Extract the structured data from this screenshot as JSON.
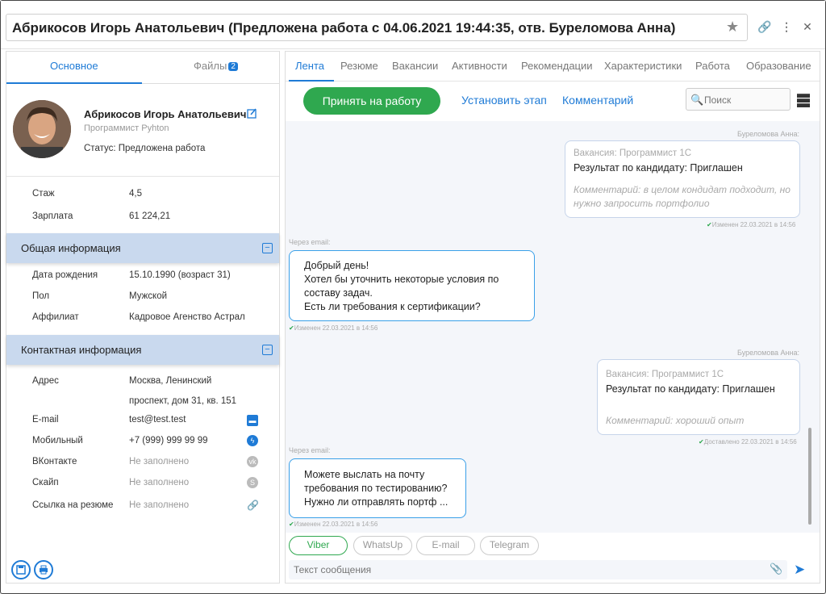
{
  "window": {
    "title": "Абрикосов Игорь Анатольевич (Предложена работа с 04.06.2021 19:44:35, отв. Буреломова Анна)"
  },
  "left": {
    "tabs": [
      {
        "label": "Основное"
      },
      {
        "label": "Файлы",
        "badge": "2"
      }
    ],
    "profile": {
      "name": "Абрикосов Игорь Анатольевич",
      "position": "Программист Pyhton",
      "status": "Статус: Предложена работа"
    },
    "summary": [
      {
        "label": "Стаж",
        "value": "4,5"
      },
      {
        "label": "Зарплата",
        "value": "61 224,21"
      }
    ],
    "general_title": "Общая информация",
    "general": [
      {
        "label": "Дата рождения",
        "value": "15.10.1990 (возраст 31)"
      },
      {
        "label": "Пол",
        "value": "Мужской"
      },
      {
        "label": "Аффилиат",
        "value": "Кадровое Агенство Астрал"
      }
    ],
    "contact_title": "Контактная информация",
    "contact": [
      {
        "label": "Адрес",
        "value": "Москва, Ленинский",
        "value2": "проспект, дом 31, кв. 151"
      },
      {
        "label": "E-mail",
        "value": "test@test.test"
      },
      {
        "label": "Мобильный",
        "value": "+7 (999) 999 99 99"
      },
      {
        "label": "ВКонтакте",
        "value": "Не заполнено"
      },
      {
        "label": "Скайп",
        "value": "Не заполнено"
      },
      {
        "label": "Ссылка на резюме",
        "value": "Не заполнено"
      }
    ]
  },
  "right": {
    "tabs": [
      "Лента",
      "Резюме",
      "Вакансии",
      "Активности",
      "Рекомендации",
      "Характеристики",
      "Работа",
      "Образование"
    ],
    "accept_label": "Принять на работу",
    "stage_label": "Установить этап",
    "comment_label": "Комментарий",
    "search_placeholder": "Поиск",
    "messages": [
      {
        "author": "Буреломова Анна:",
        "vacancy": "Вакансия: Программист 1С",
        "result": "Результат по кандидату: Приглашен",
        "comment1": "Комментарий: в целом кондидат подходит, но",
        "comment2": "нужно запросить портфолио",
        "footer": "Изменен 22.03.2021 в 14:56"
      },
      {
        "author": "Через email:",
        "line1": "Добрый день!",
        "line2": "Хотел бы уточнить некоторые условия по",
        "line3": "составу задач.",
        "line4": "Есть ли требования к сертификации?",
        "footer": "Изменен 22.03.2021 в 14:56"
      },
      {
        "author": "Буреломова Анна:",
        "vacancy": "Вакансия: Программист 1С",
        "result": "Результат по кандидату: Приглашен",
        "comment1": "Комментарий: хороший опыт",
        "footer": "Доставлено 22.03.2021 в 14:56"
      },
      {
        "author": "Через email:",
        "line1": "Можете выслать на почту",
        "line2": "требования по тестированию?",
        "line3": "Нужно ли отправлять портф ...",
        "footer": "Изменен 22.03.2021 в 14:56"
      }
    ],
    "channels": [
      "Viber",
      "WhatsUp",
      "E-mail",
      "Telegram"
    ],
    "message_placeholder": "Текст сообщения"
  },
  "colors": {
    "accent": "#1f7bd6",
    "success": "#2fa84f",
    "section": "#c9d9ee"
  }
}
